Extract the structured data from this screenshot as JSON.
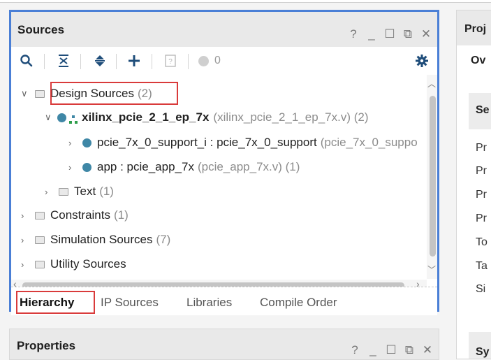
{
  "sources": {
    "title": "Sources",
    "controls": {
      "help": "?",
      "minimize": "_",
      "maximize": "☐",
      "float": "⧉",
      "close": "✕"
    },
    "toolbar": {
      "error_count": "0"
    },
    "tree": {
      "design_sources": {
        "label": "Design Sources",
        "count": "(2)"
      },
      "top": {
        "label": "xilinx_pcie_2_1_ep_7x",
        "file": "(xilinx_pcie_2_1_ep_7x.v) (2)"
      },
      "child1": {
        "label": "pcie_7x_0_support_i : pcie_7x_0_support",
        "file": "(pcie_7x_0_suppo"
      },
      "child2": {
        "label": "app : pcie_app_7x",
        "file": "(pcie_app_7x.v) (1)"
      },
      "text": {
        "label": "Text",
        "count": "(1)"
      },
      "constraints": {
        "label": "Constraints",
        "count": "(1)"
      },
      "simulation": {
        "label": "Simulation Sources",
        "count": "(7)"
      },
      "utility": {
        "label": "Utility Sources",
        "count": ""
      }
    },
    "tabs": {
      "hierarchy": "Hierarchy",
      "ip_sources": "IP Sources",
      "libraries": "Libraries",
      "compile_order": "Compile Order"
    }
  },
  "properties": {
    "title": "Properties",
    "controls": {
      "help": "?",
      "minimize": "_",
      "maximize": "☐",
      "float": "⧉",
      "close": "✕"
    }
  },
  "project": {
    "title": "Proj",
    "tab": "Ov",
    "section": "Se",
    "items": [
      "Pr",
      "Pr",
      "Pr",
      "Pr",
      "To",
      "Ta",
      "Si"
    ],
    "bottom_section": "Sy"
  }
}
